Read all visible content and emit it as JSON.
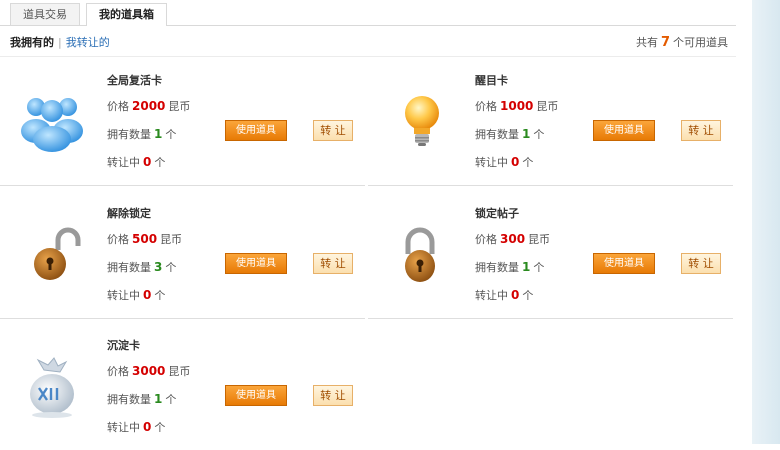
{
  "tabs": [
    "道具交易",
    "我的道具箱"
  ],
  "filter": {
    "owned": "我拥有的",
    "separator": "|",
    "transferred": "我转让的"
  },
  "summary": {
    "prefix": "共有",
    "count": "7",
    "suffix": "个可用道具"
  },
  "labels": {
    "price": "价格",
    "currency": "昆币",
    "owned": "拥有数量",
    "unit": "个",
    "transfer": "转让中",
    "use_button": "使用道具",
    "transfer_button": "转 让"
  },
  "items": [
    {
      "name": "全局复活卡",
      "price": "2000",
      "owned": "1",
      "transferring": "0",
      "icon": "people-icon"
    },
    {
      "name": "醒目卡",
      "price": "1000",
      "owned": "1",
      "transferring": "0",
      "icon": "lightbulb-icon"
    },
    {
      "name": "解除锁定",
      "price": "500",
      "owned": "3",
      "transferring": "0",
      "icon": "unlock-icon"
    },
    {
      "name": "锁定帖子",
      "price": "300",
      "owned": "1",
      "transferring": "0",
      "icon": "lock-icon"
    },
    {
      "name": "沉淀卡",
      "price": "3000",
      "owned": "1",
      "transferring": "0",
      "icon": "bag-icon"
    }
  ]
}
